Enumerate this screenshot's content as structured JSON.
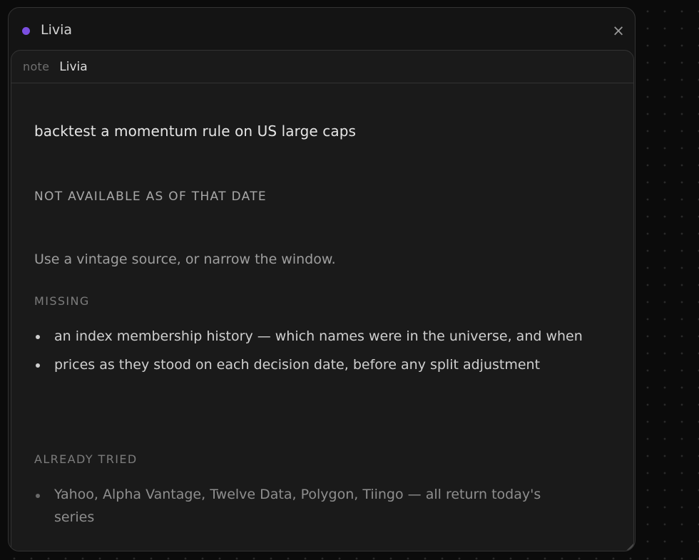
{
  "window": {
    "title": "Livia",
    "status_color": "#7b4fe0",
    "close_label": "×"
  },
  "pane": {
    "kind": "note",
    "name": "Livia"
  },
  "note": {
    "prompt": "backtest a momentum rule on US large caps",
    "verdict": "NOT AVAILABLE AS OF THAT DATE",
    "advice": "Use a vintage source, or narrow the window.",
    "missing_label": "MISSING",
    "missing_items": [
      "an index membership history — which names were in the universe, and when",
      "prices as they stood on each decision date, before any split adjustment"
    ],
    "tried_label": "ALREADY TRIED",
    "tried_items": [
      "Yahoo, Alpha Vantage, Twelve Data, Polygon, Tiingo — all return today's series"
    ]
  }
}
